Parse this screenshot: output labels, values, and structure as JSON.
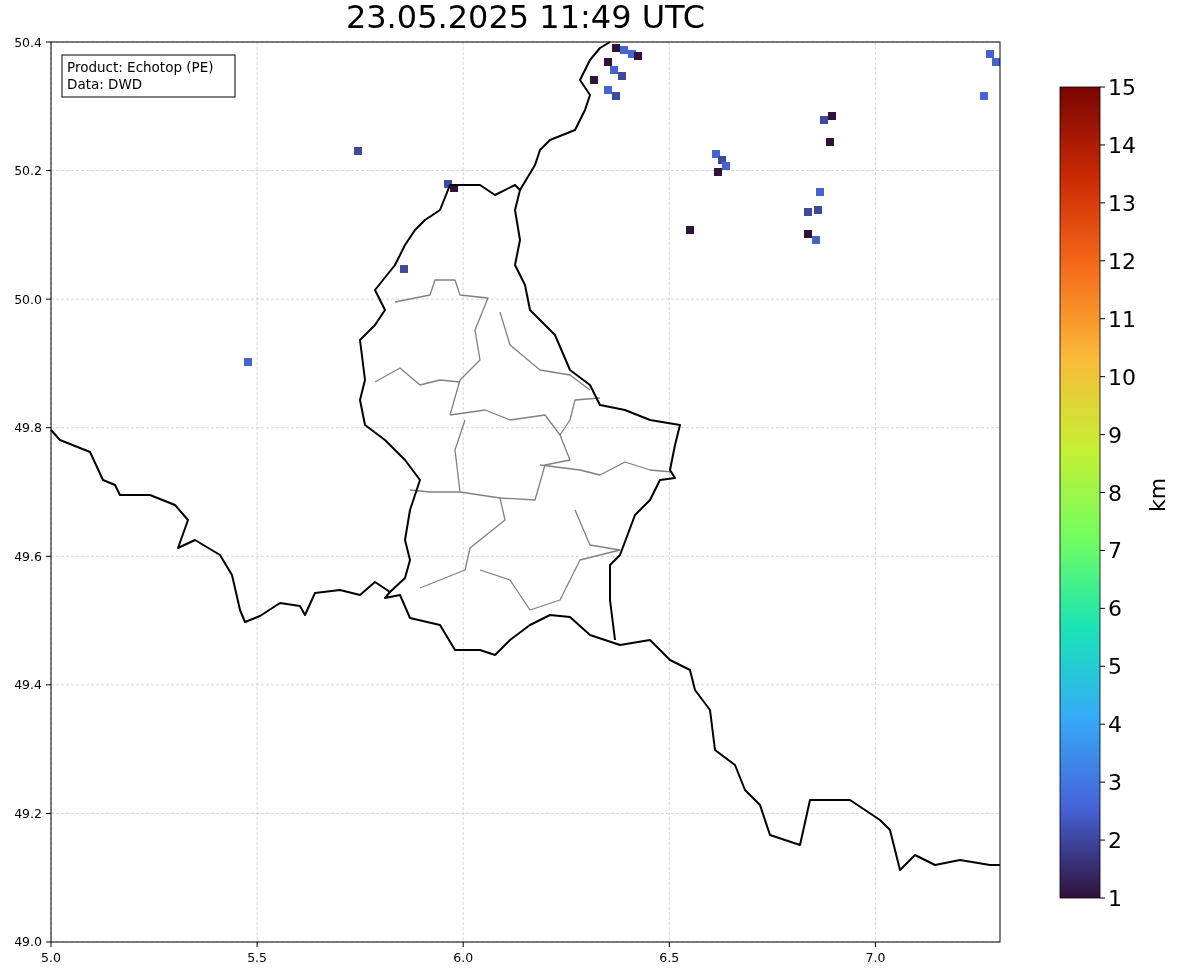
{
  "title": "23.05.2025 11:49 UTC",
  "legend": [
    "Product: Echotop (PE)",
    "Data: DWD"
  ],
  "axes": {
    "xticks": [
      "5.0",
      "5.5",
      "6.0",
      "6.5",
      "7.0"
    ],
    "yticks": [
      "50.4",
      "50.2",
      "50.0",
      "49.8",
      "49.6",
      "49.4",
      "49.2",
      "49.0"
    ]
  },
  "colorbar": {
    "label": "km",
    "ticks": [
      "15",
      "14",
      "13",
      "12",
      "11",
      "10",
      "9",
      "8",
      "7",
      "6",
      "5",
      "4",
      "3",
      "2",
      "1"
    ]
  }
}
